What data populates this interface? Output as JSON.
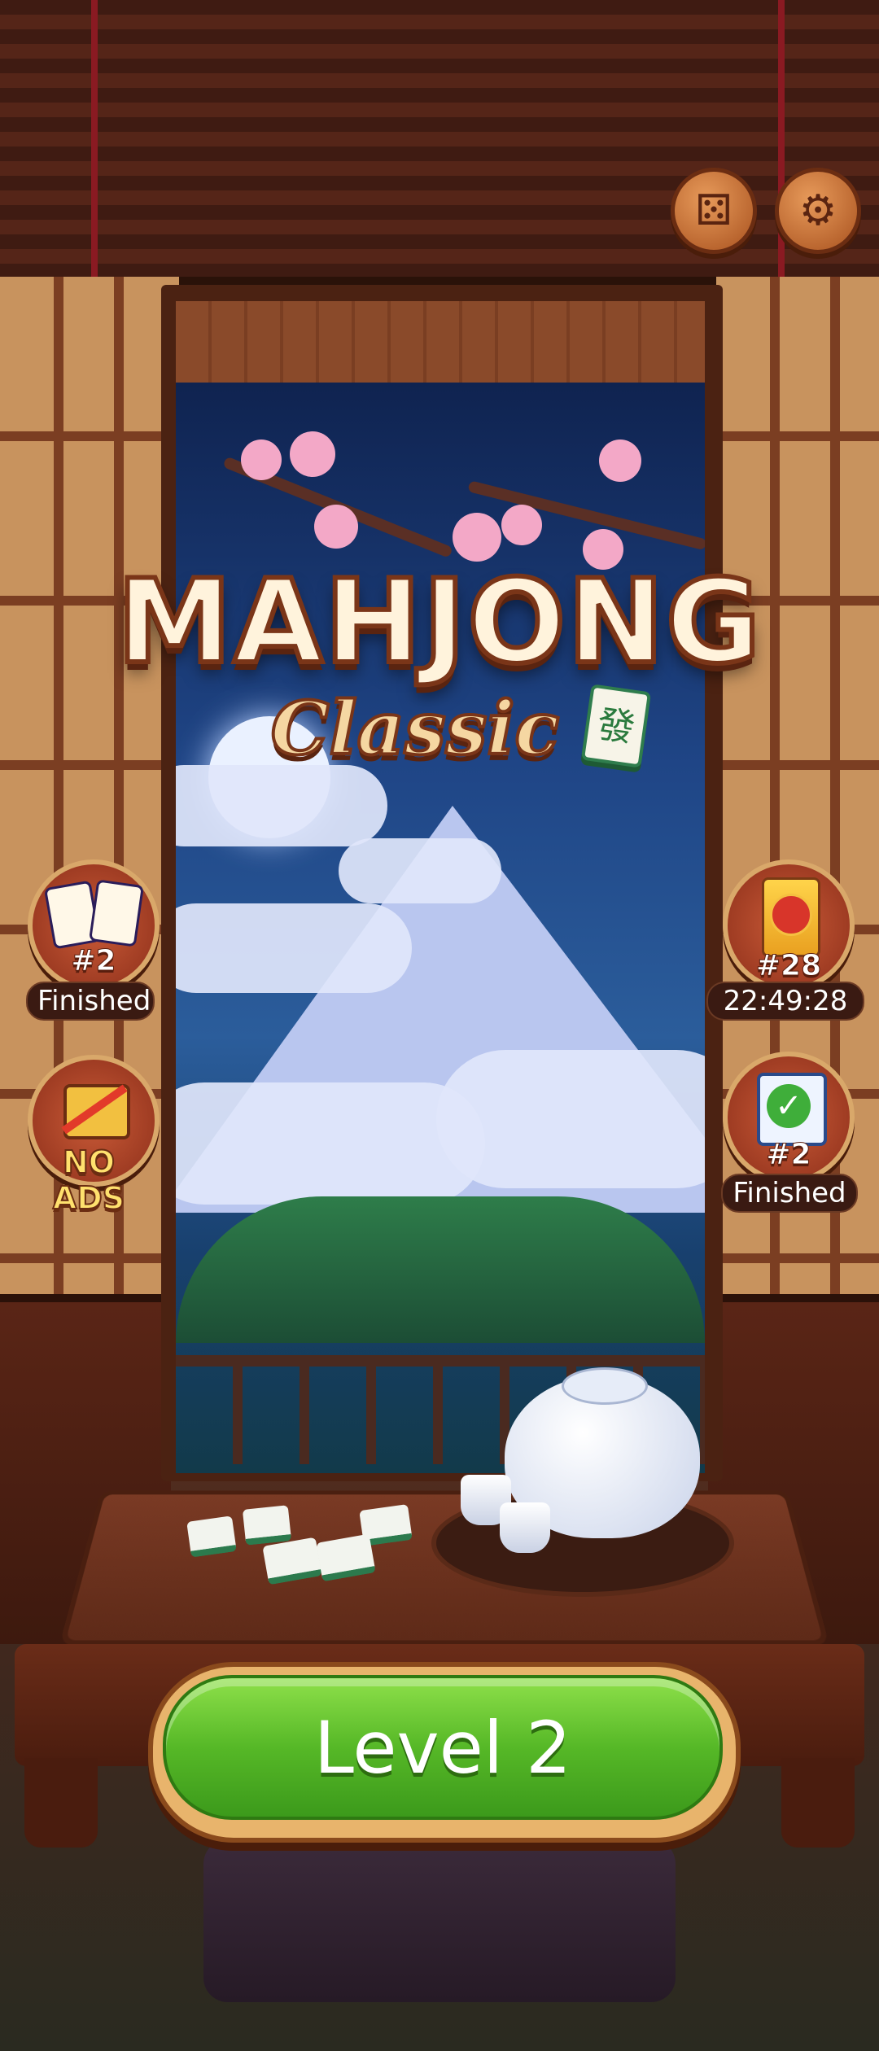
{
  "app": {
    "title_main": "MAHJONG",
    "title_sub": "Classic",
    "logo_tile_glyph": "發"
  },
  "top_buttons": {
    "shop_icon": "dice-icon",
    "settings_icon": "gear-icon"
  },
  "left_badges": [
    {
      "name": "dragon-tiles-event",
      "number": "#2",
      "label": "Finished",
      "icon": "dragon-tiles-icon"
    },
    {
      "name": "no-ads",
      "label": "NO ADS",
      "icon": "no-ads-icon"
    }
  ],
  "right_badges": [
    {
      "name": "lantern-event",
      "number": "#28",
      "label": "22:49:28",
      "icon": "lantern-card-icon"
    },
    {
      "name": "daily-challenge",
      "number": "#2",
      "label": "Finished",
      "icon": "calendar-check-icon"
    }
  ],
  "play_button": {
    "label": "Level 2"
  },
  "colors": {
    "accent_green": "#56b827",
    "wood": "#7a3a24",
    "badge_red": "#c95a37"
  }
}
